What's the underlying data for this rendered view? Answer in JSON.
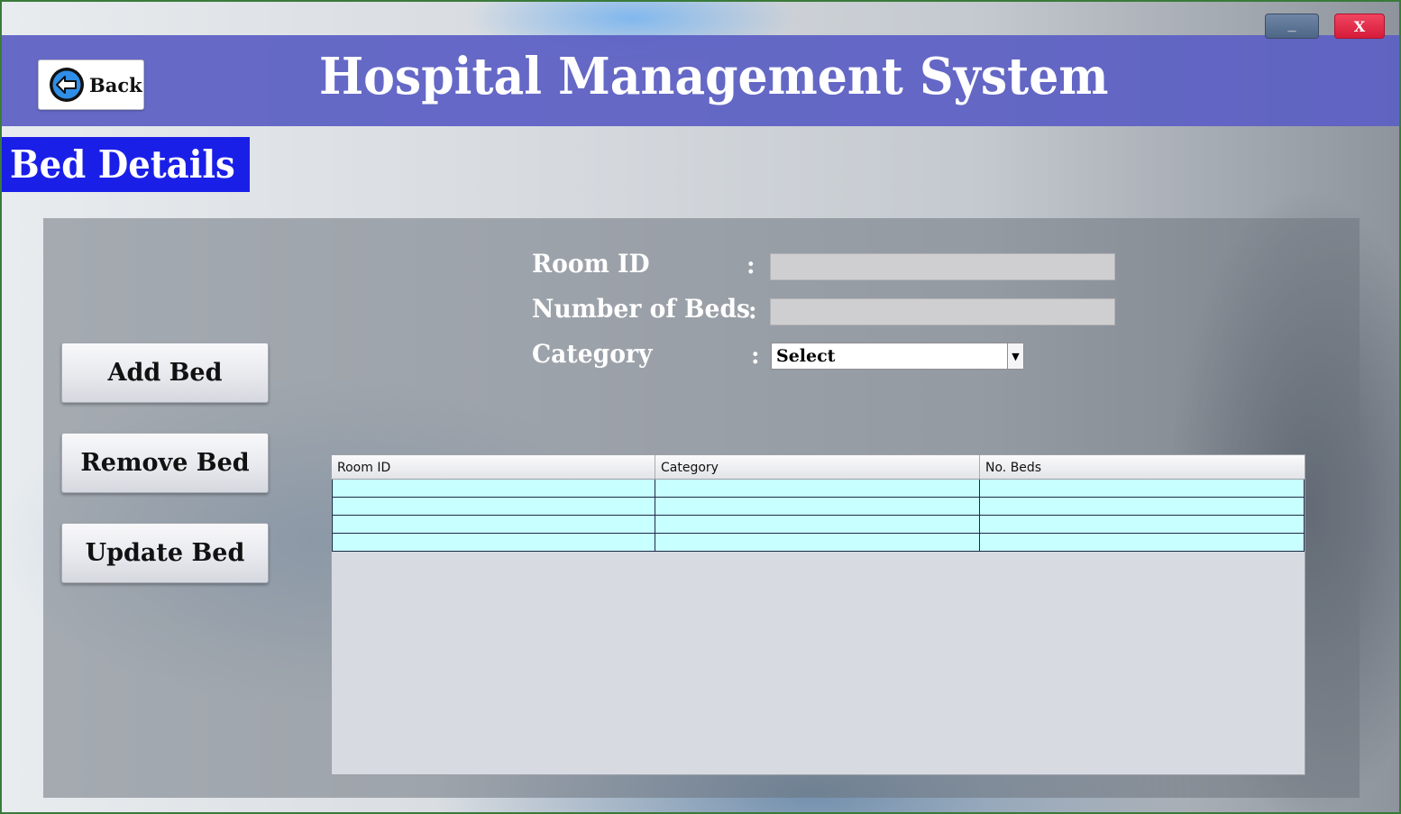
{
  "window": {
    "minimize_label": "_",
    "close_label": "X"
  },
  "header": {
    "title": "Hospital Management System",
    "back_label": "Back"
  },
  "section": {
    "title": "Bed Details"
  },
  "actions": {
    "add_label": "Add Bed",
    "remove_label": "Remove Bed",
    "update_label": "Update Bed"
  },
  "form": {
    "room_id_label": "Room ID",
    "beds_label": "Number of Beds",
    "category_label": "Category",
    "separator": ":",
    "room_id_value": "",
    "beds_value": "",
    "category_selected": "Select"
  },
  "table": {
    "columns": [
      "Room ID",
      "Category",
      "No. Beds"
    ],
    "rows": [
      [
        "",
        "",
        ""
      ],
      [
        "",
        "",
        ""
      ],
      [
        "",
        "",
        ""
      ],
      [
        "",
        "",
        ""
      ]
    ]
  },
  "colors": {
    "header_band": "#5e61c4",
    "section_title_bg": "#1a1fe8",
    "table_row_bg": "#c8ffff",
    "close_button": "#e02a45",
    "minimize_button": "#5a7294"
  },
  "icons": {
    "back": "back-arrow-circle-icon",
    "dropdown": "chevron-down-icon"
  }
}
